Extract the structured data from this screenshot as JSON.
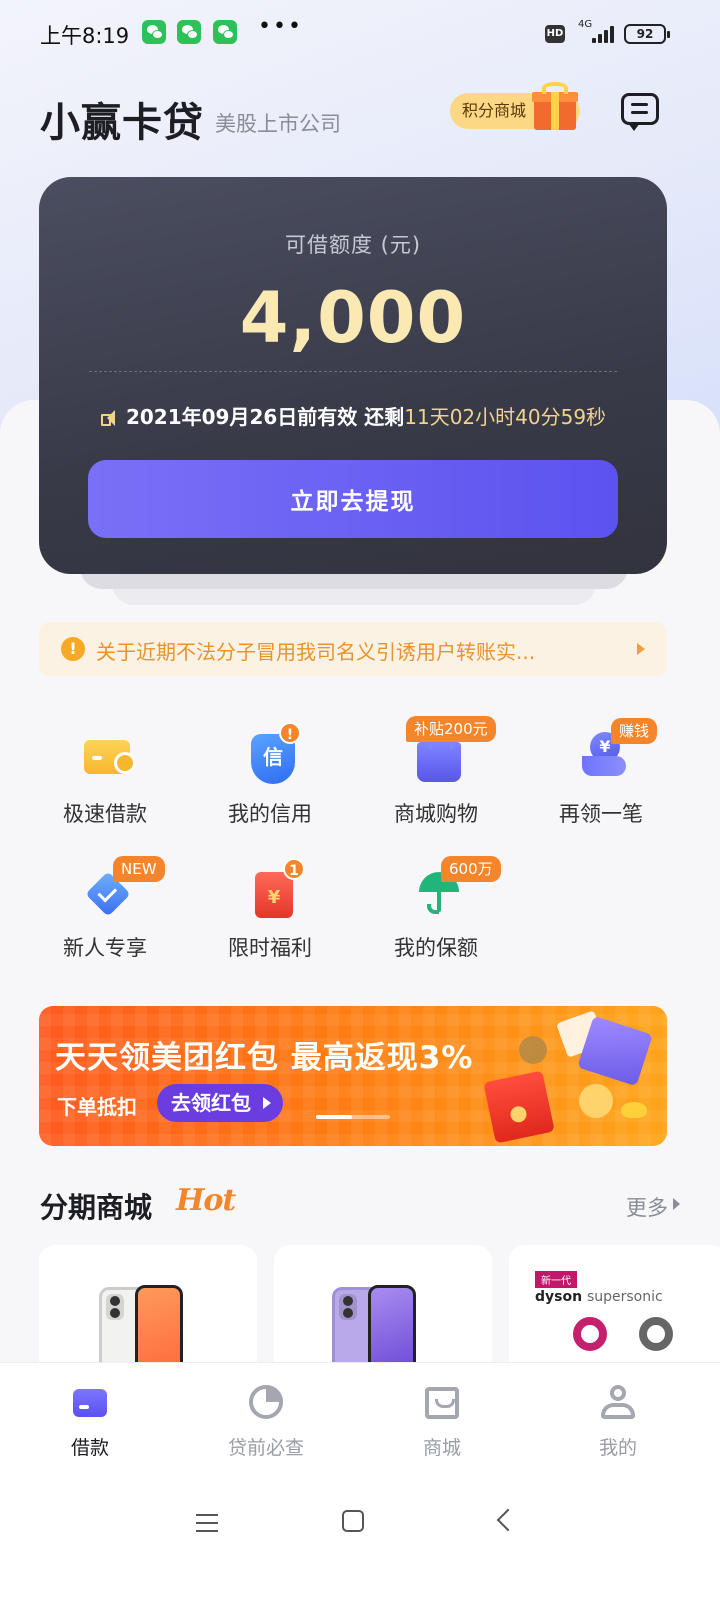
{
  "status_bar": {
    "time": "上午8:19",
    "more": "•••",
    "hd": "HD",
    "network": "4G",
    "battery": "92"
  },
  "header": {
    "title": "小赢卡贷",
    "subtitle": "美股上市公司",
    "points_mall": "积分商城",
    "icons": [
      "gift-icon",
      "message-icon"
    ]
  },
  "credit_card": {
    "label": "可借额度 (元)",
    "amount": "4,000",
    "valid_text": "2021年09月26日前有效  还剩",
    "countdown": "11天02小时40分59秒",
    "button": "立即去提现"
  },
  "notice": {
    "text": "关于近期不法分子冒用我司名义引诱用户转账实..."
  },
  "grid": [
    {
      "label": "极速借款",
      "tag": "",
      "icon": "card-coin-icon"
    },
    {
      "label": "我的信用",
      "tag": "!",
      "icon": "shield-icon",
      "icon_text": "信"
    },
    {
      "label": "商城购物",
      "tag": "补贴200元",
      "icon": "shopping-bag-icon"
    },
    {
      "label": "再领一笔",
      "tag": "赚钱",
      "icon": "hand-coin-icon",
      "icon_text": "¥"
    },
    {
      "label": "新人专享",
      "tag": "NEW",
      "icon": "diamond-check-icon"
    },
    {
      "label": "限时福利",
      "tag": "1",
      "icon": "red-envelope-icon",
      "icon_text": "¥"
    },
    {
      "label": "我的保额",
      "tag": "600万",
      "icon": "umbrella-icon"
    }
  ],
  "banner": {
    "headline": "天天领美团红包 最高返现3%",
    "sub": "下单抵扣",
    "button": "去领红包"
  },
  "mall_section": {
    "title": "分期商城",
    "hot": "Hot",
    "more": "更多",
    "products": [
      {
        "name": "iphone-white",
        "color": "#f2f2f0"
      },
      {
        "name": "iphone-purple",
        "color": "#b9a8ea"
      },
      {
        "name": "dyson-supersonic",
        "tag": "新一代",
        "brand": "dyson",
        "model": "supersonic"
      }
    ]
  },
  "tabbar": [
    {
      "label": "借款",
      "active": true
    },
    {
      "label": "贷前必查",
      "active": false
    },
    {
      "label": "商城",
      "active": false
    },
    {
      "label": "我的",
      "active": false
    }
  ],
  "colors": {
    "accent": "#5c52ef",
    "gold": "#f2d38d",
    "orange": "#f5852a",
    "card_bg": "#383a48"
  }
}
